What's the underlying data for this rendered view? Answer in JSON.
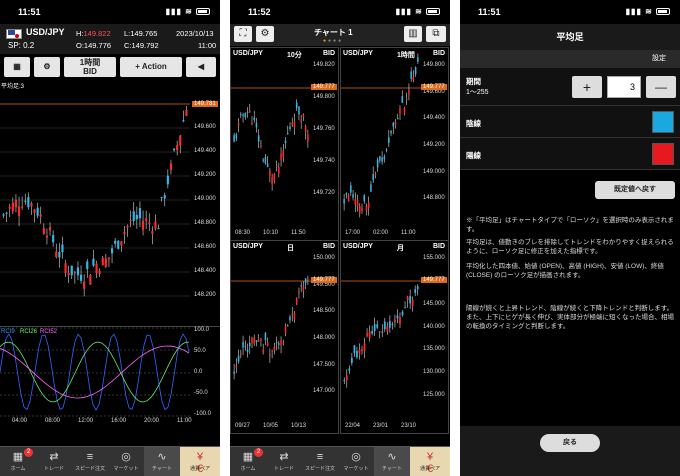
{
  "phone1": {
    "time": "11:51",
    "pair": "USD/JPY",
    "spread": "SP: 0.2",
    "h_label": "H:",
    "h_val": "149.822",
    "l_label": "L:",
    "l_val": "149.765",
    "o_label": "O:",
    "o_val": "149.776",
    "c_label": "C:",
    "c_val": "149.792",
    "date": "2023/10/13",
    "clock": "11:00",
    "timeframe": "1時間",
    "price_type": "BID",
    "action_label": "Action",
    "indicator_label": "平均足:3",
    "current_price": "149.781",
    "y_labels": [
      "149.600",
      "149.400",
      "149.200",
      "149.000",
      "148.800",
      "148.600",
      "148.400",
      "148.200"
    ],
    "x_labels": [
      "04:00",
      "08:00",
      "12:00",
      "16:00",
      "20:00",
      "11:00"
    ],
    "rci_label": "RCI9",
    "rci_a": "RCI26",
    "rci_b": "RCI52",
    "rci_levels": [
      "100.0",
      "50.0",
      "0.0",
      "-50.0",
      "-100.0"
    ],
    "nav": [
      {
        "label": "ホーム",
        "badge": "2"
      },
      {
        "label": "トレード"
      },
      {
        "label": "スピード注文"
      },
      {
        "label": "マーケット"
      },
      {
        "label": "チャート"
      },
      {
        "label": "通貨ペア"
      }
    ]
  },
  "phone2": {
    "time": "11:52",
    "title": "チャート 1",
    "cells": [
      {
        "pair": "USD/JPY",
        "tf": "10分",
        "pt": "BID",
        "price": "149.777",
        "y": [
          "149.820",
          "149.800",
          "149.760",
          "149.740",
          "149.720"
        ],
        "x": [
          "08:30",
          "10:10",
          "11:50"
        ]
      },
      {
        "pair": "USD/JPY",
        "tf": "1時間",
        "pt": "BID",
        "price": "149.777",
        "y": [
          "149.800",
          "149.600",
          "149.400",
          "149.200",
          "149.000",
          "148.800"
        ],
        "x": [
          "17:00",
          "02:00",
          "11:00"
        ]
      },
      {
        "pair": "USD/JPY",
        "tf": "日",
        "pt": "BID",
        "price": "149.777",
        "y": [
          "150.000",
          "149.500",
          "148.500",
          "148.000",
          "147.500",
          "147.000"
        ],
        "x": [
          "09/27",
          "10/05",
          "10/13"
        ]
      },
      {
        "pair": "USD/JPY",
        "tf": "月",
        "pt": "BID",
        "price": "149.777",
        "y": [
          "155.000",
          "150.000",
          "145.000",
          "140.000",
          "135.000",
          "130.000",
          "125.000"
        ],
        "x": [
          "22/04",
          "23/01",
          "23/10"
        ]
      }
    ]
  },
  "phone3": {
    "time": "11:51",
    "title": "平均足",
    "settings_label": "設定",
    "period_label": "期間",
    "period_range": "1〜255",
    "period_value": "3",
    "plus": "+",
    "minus": "—",
    "inline_label": "陰線",
    "yang_label": "陽線",
    "inline_color": "#1aa8e0",
    "yang_color": "#e8191e",
    "reset_label": "既定値へ戻す",
    "desc": [
      "※「平均足」はチャートタイプで「ローソク」を選択時のみ表示されます。",
      "平均足は、値動きのブレを排除してトレンドをわかりやすく捉えられるように、ローソク足に修正を加えた指標です。",
      "平均化した四本値、始値 (OPEN)、高値 (HIGH)、安値 (LOW)、終値 (CLOSE) のローソク足が描画されます。",
      "陽線が続くと上昇トレンド、陰線が続くと下降トレンドと判断します。また、上下にヒゲが長く伸び、実体部分が極端に短くなった場合、相場の転換のタイミングと判断します。"
    ],
    "back_label": "戻る"
  }
}
